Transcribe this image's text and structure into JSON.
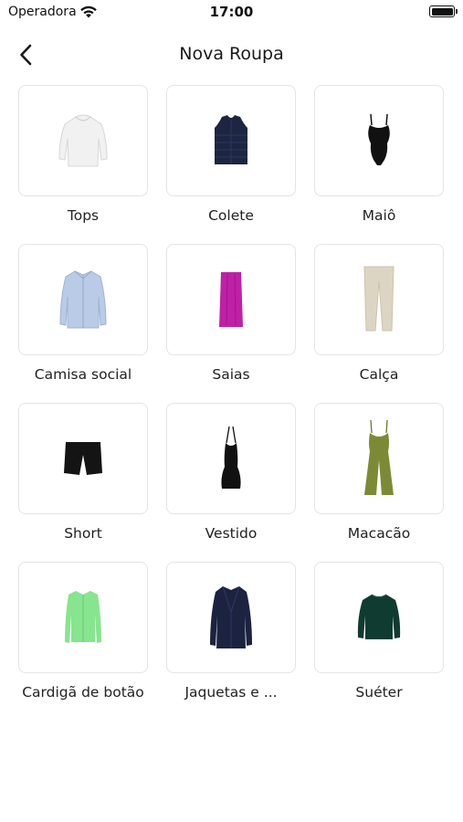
{
  "status_bar": {
    "carrier": "Operadora",
    "time": "17:00"
  },
  "header": {
    "title": "Nova Roupa",
    "back_icon": "chevron-left-icon"
  },
  "categories": [
    {
      "label": "Tops",
      "icon": "sweatshirt-image"
    },
    {
      "label": "Colete",
      "icon": "vest-image"
    },
    {
      "label": "Maiô",
      "icon": "swimsuit-image"
    },
    {
      "label": "Camisa social",
      "icon": "dress-shirt-image"
    },
    {
      "label": "Saias",
      "icon": "skirt-image"
    },
    {
      "label": "Calça",
      "icon": "pants-image"
    },
    {
      "label": "Short",
      "icon": "shorts-image"
    },
    {
      "label": "Vestido",
      "icon": "dress-image"
    },
    {
      "label": "Macacão",
      "icon": "jumpsuit-image"
    },
    {
      "label": "Cardigã de botão",
      "icon": "cardigan-image"
    },
    {
      "label": "Jaquetas e ...",
      "icon": "coat-image"
    },
    {
      "label": "Suéter",
      "icon": "sweater-image"
    }
  ],
  "colors": {
    "sweatshirt": "#f1f1f1",
    "vest": "#1c2541",
    "swimsuit": "#111111",
    "dress_shirt": "#b9cbe6",
    "skirt": "#c020a6",
    "pants": "#ddd5c3",
    "shorts": "#141414",
    "dress": "#111111",
    "jumpsuit": "#7d8a35",
    "cardigan": "#86e58e",
    "coat": "#1c2340",
    "sweater": "#0f3b30"
  }
}
